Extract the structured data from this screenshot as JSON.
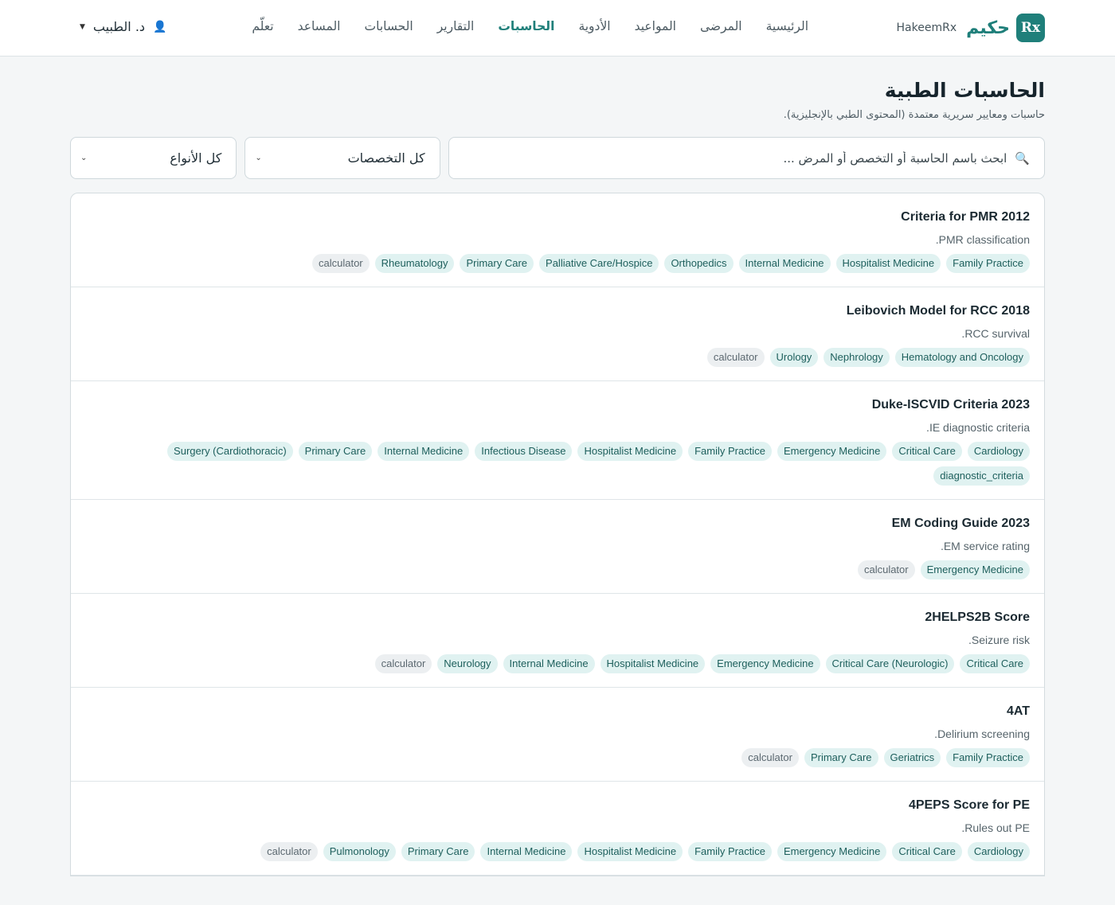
{
  "brand": {
    "logo": "Rx",
    "name_ar": "حكيم",
    "name_en": "HakeemRx"
  },
  "nav": [
    {
      "label": "الرئيسية",
      "active": false
    },
    {
      "label": "المرضى",
      "active": false
    },
    {
      "label": "المواعيد",
      "active": false
    },
    {
      "label": "الأدوية",
      "active": false
    },
    {
      "label": "الحاسبات",
      "active": true
    },
    {
      "label": "التقارير",
      "active": false
    },
    {
      "label": "الحسابات",
      "active": false
    },
    {
      "label": "المساعد",
      "active": false
    },
    {
      "label": "تعلّم",
      "active": false
    }
  ],
  "user": {
    "name": "د. الطبيب",
    "icon": "user-icon"
  },
  "page": {
    "title": "الحاسبات الطبية",
    "subtitle": "حاسبات ومعايير سريرية معتمدة (المحتوى الطبي بالإنجليزية)."
  },
  "filters": {
    "search_placeholder": "ابحث باسم الحاسبة أو التخصص أو المرض ...",
    "search_value": "",
    "specialty_selected": "كل التخصصات",
    "type_selected": "كل الأنواع"
  },
  "colors": {
    "accent": "#1f7f7a",
    "tag_bg": "#e0f2f1",
    "tag_kind_bg": "#eceff1"
  },
  "calculators": [
    {
      "title": "2012 Criteria for PMR",
      "desc": "PMR classification.",
      "tags": [
        "Family Practice",
        "Hospitalist Medicine",
        "Internal Medicine",
        "Orthopedics",
        "Palliative Care/Hospice",
        "Primary Care",
        "Rheumatology"
      ],
      "kind": [
        "calculator"
      ]
    },
    {
      "title": "2018 Leibovich Model for RCC",
      "desc": "RCC survival.",
      "tags": [
        "Hematology and Oncology",
        "Nephrology",
        "Urology"
      ],
      "kind": [
        "calculator"
      ]
    },
    {
      "title": "2023 Duke-ISCVID Criteria",
      "desc": "IE diagnostic criteria.",
      "tags": [
        "Cardiology",
        "Critical Care",
        "Emergency Medicine",
        "Family Practice",
        "Hospitalist Medicine",
        "Infectious Disease",
        "Internal Medicine",
        "Primary Care",
        "Surgery (Cardiothoracic)"
      ],
      "kind": [
        "diagnostic_criteria"
      ]
    },
    {
      "title": "2023 EM Coding Guide",
      "desc": "EM service rating.",
      "tags": [
        "Emergency Medicine"
      ],
      "kind": [
        "calculator"
      ]
    },
    {
      "title": "2HELPS2B Score",
      "desc": "Seizure risk.",
      "tags": [
        "Critical Care",
        "Critical Care (Neurologic)",
        "Emergency Medicine",
        "Hospitalist Medicine",
        "Internal Medicine",
        "Neurology"
      ],
      "kind": [
        "calculator"
      ]
    },
    {
      "title": "4AT",
      "desc": "Delirium screening.",
      "tags": [
        "Family Practice",
        "Geriatrics",
        "Primary Care"
      ],
      "kind": [
        "calculator"
      ]
    },
    {
      "title": "4PEPS Score for PE",
      "desc": "Rules out PE.",
      "tags": [
        "Cardiology",
        "Critical Care",
        "Emergency Medicine",
        "Family Practice",
        "Hospitalist Medicine",
        "Internal Medicine",
        "Primary Care",
        "Pulmonology"
      ],
      "kind": [
        "calculator"
      ]
    }
  ]
}
